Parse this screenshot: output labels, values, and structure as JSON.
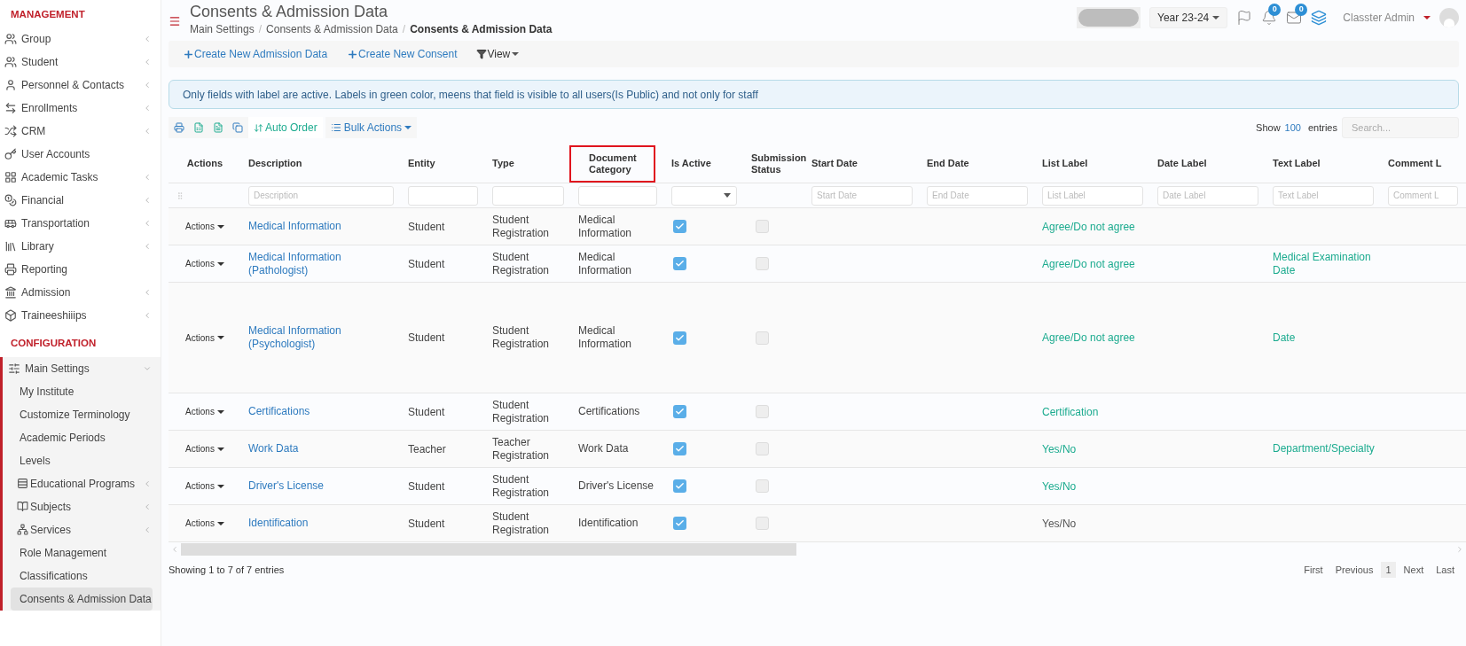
{
  "sidebar": {
    "sections": [
      {
        "title": "MANAGEMENT",
        "items": [
          {
            "label": "Group",
            "chevron": true
          },
          {
            "label": "Student",
            "chevron": true
          },
          {
            "label": "Personnel & Contacts",
            "chevron": true
          },
          {
            "label": "Enrollments",
            "chevron": true
          },
          {
            "label": "CRM",
            "chevron": true
          },
          {
            "label": "User Accounts",
            "chevron": false
          },
          {
            "label": "Academic Tasks",
            "chevron": true
          },
          {
            "label": "Financial",
            "chevron": true
          },
          {
            "label": "Transportation",
            "chevron": true
          },
          {
            "label": "Library",
            "chevron": true
          },
          {
            "label": "Reporting",
            "chevron": false
          },
          {
            "label": "Admission",
            "chevron": true
          },
          {
            "label": "Traineeshiiips",
            "chevron": true
          }
        ]
      },
      {
        "title": "CONFIGURATION",
        "items": [
          {
            "label": "Main Settings",
            "chevron": true,
            "expanded": true,
            "children": [
              {
                "label": "My Institute",
                "icon": false,
                "chevron": false,
                "selected": false
              },
              {
                "label": "Customize Terminology",
                "icon": false,
                "chevron": false,
                "selected": false
              },
              {
                "label": "Academic Periods",
                "icon": false,
                "chevron": false,
                "selected": false
              },
              {
                "label": "Levels",
                "icon": false,
                "chevron": false,
                "selected": false
              },
              {
                "label": "Educational Programs",
                "icon": true,
                "chevron": true,
                "selected": false
              },
              {
                "label": "Subjects",
                "icon": true,
                "chevron": true,
                "selected": false
              },
              {
                "label": "Services",
                "icon": true,
                "chevron": true,
                "selected": false
              },
              {
                "label": "Role Management",
                "icon": false,
                "chevron": false,
                "selected": false
              },
              {
                "label": "Classifications",
                "icon": false,
                "chevron": false,
                "selected": false
              },
              {
                "label": "Consents & Admission Data",
                "icon": false,
                "chevron": false,
                "selected": true
              }
            ]
          }
        ]
      }
    ]
  },
  "header": {
    "title": "Consents & Admission Data",
    "separator": "/",
    "breadcrumb": [
      "Main Settings",
      "Consents & Admission Data",
      "Consents & Admission Data"
    ],
    "year": "Year 23-24",
    "notifications": "0",
    "messages": "0",
    "user": "Classter Admin"
  },
  "toolbar": [
    "Create New Admission Data",
    "Create New Consent"
  ],
  "view_button": "View",
  "alert": "Only fields with label are active. Labels in green color, meens that field is visible to all users(Is Public) and not only for staff",
  "table_tools": {
    "auto_order": "Auto Order",
    "bulk_actions": "Bulk Actions",
    "show": "Show",
    "page_size": "100",
    "entries": "entries",
    "search_placeholder": "Search..."
  },
  "table": {
    "columns": [
      {
        "label": "Actions",
        "kind": "handle",
        "highlighted": false
      },
      {
        "label": "Description",
        "kind": "text",
        "placeholder": "Description",
        "highlighted": false
      },
      {
        "label": "Entity",
        "kind": "text",
        "highlighted": false
      },
      {
        "label": "Type",
        "kind": "text",
        "highlighted": false
      },
      {
        "label": "Document Category",
        "kind": "text",
        "highlighted": true
      },
      {
        "label": "Is Active",
        "kind": "select",
        "highlighted": false
      },
      {
        "label": "Submission Status",
        "kind": "none",
        "highlighted": false
      },
      {
        "label": "Start Date",
        "kind": "text",
        "placeholder": "Start Date",
        "highlighted": false
      },
      {
        "label": "End Date",
        "kind": "text",
        "placeholder": "End Date",
        "highlighted": false
      },
      {
        "label": "List Label",
        "kind": "text",
        "placeholder": "List Label",
        "highlighted": false
      },
      {
        "label": "Date Label",
        "kind": "text",
        "placeholder": "Date Label",
        "highlighted": false
      },
      {
        "label": "Text Label",
        "kind": "text",
        "placeholder": "Text Label",
        "highlighted": false
      },
      {
        "label": "Comment L",
        "kind": "text",
        "placeholder": "Comment L",
        "highlighted": false
      }
    ],
    "rows": [
      {
        "actions": "Actions",
        "description": "Medical Information",
        "entity": "Student",
        "type": "Student Registration",
        "category": "Medical Information",
        "is_active": true,
        "submission": false,
        "list_label": {
          "text": "Agree/Do not agree",
          "public": true
        },
        "tall": false
      },
      {
        "actions": "Actions",
        "description": "Medical Information (Pathologist)",
        "entity": "Student",
        "type": "Student Registration",
        "category": "Medical Information",
        "is_active": true,
        "submission": false,
        "list_label": {
          "text": "Agree/Do not agree",
          "public": true
        },
        "text_label": {
          "text": "Medical Examination Date",
          "public": true
        },
        "tall": false
      },
      {
        "actions": "Actions",
        "description": "Medical Information (Psychologist)",
        "entity": "Student",
        "type": "Student Registration",
        "category": "Medical Information",
        "is_active": true,
        "submission": false,
        "list_label": {
          "text": "Agree/Do not agree",
          "public": true
        },
        "text_label": {
          "text": "Date",
          "public": true
        },
        "tall": true
      },
      {
        "actions": "Actions",
        "description": "Certifications",
        "entity": "Student",
        "type": "Student Registration",
        "category": "Certifications",
        "is_active": true,
        "submission": false,
        "list_label": {
          "text": "Certification",
          "public": true
        },
        "tall": false
      },
      {
        "actions": "Actions",
        "description": "Work Data",
        "entity": "Teacher",
        "type": "Teacher Registration",
        "category": "Work Data",
        "is_active": true,
        "submission": false,
        "list_label": {
          "text": "Yes/No",
          "public": true
        },
        "text_label": {
          "text": "Department/Specialty",
          "public": true
        },
        "tall": false
      },
      {
        "actions": "Actions",
        "description": "Driver's License",
        "entity": "Student",
        "type": "Student Registration",
        "category": "Driver's License",
        "is_active": true,
        "submission": false,
        "list_label": {
          "text": "Yes/No",
          "public": true
        },
        "tall": false
      },
      {
        "actions": "Actions",
        "description": "Identification",
        "entity": "Student",
        "type": "Student Registration",
        "category": "Identification",
        "is_active": true,
        "submission": false,
        "list_label": {
          "text": "Yes/No",
          "public": false
        },
        "tall": false
      }
    ]
  },
  "footer": {
    "info": "Showing 1 to 7 of 7 entries",
    "pagination": [
      {
        "label": "First",
        "selected": false
      },
      {
        "label": "Previous",
        "selected": false
      },
      {
        "label": "1",
        "selected": true
      },
      {
        "label": "Next",
        "selected": false
      },
      {
        "label": "Last",
        "selected": false
      }
    ]
  }
}
